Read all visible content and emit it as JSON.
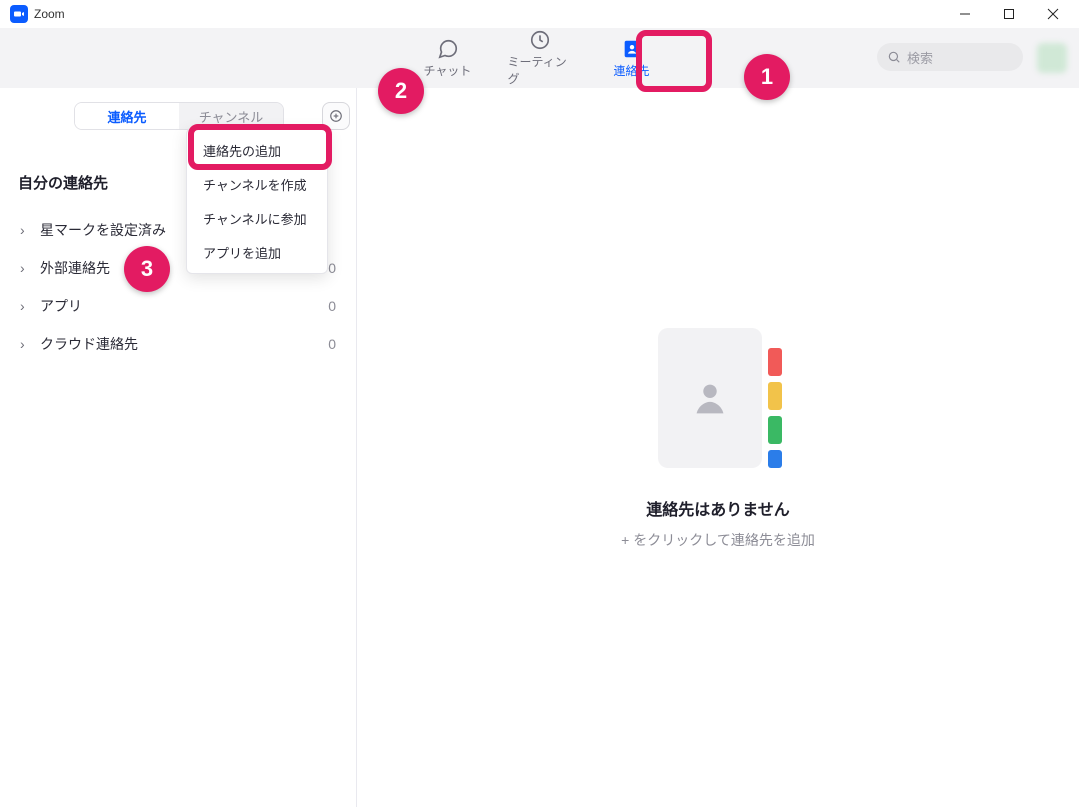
{
  "window": {
    "title": "Zoom"
  },
  "nav": {
    "chat": "チャット",
    "meetings": "ミーティング",
    "contacts": "連絡先"
  },
  "search": {
    "placeholder": "検索"
  },
  "subtabs": {
    "contacts": "連絡先",
    "channels": "チャンネル"
  },
  "dropdown": {
    "add_contact": "連絡先の追加",
    "create_channel": "チャンネルを作成",
    "join_channel": "チャンネルに参加",
    "add_app": "アプリを追加"
  },
  "sidebar": {
    "section_title": "自分の連絡先",
    "items": [
      {
        "label": "星マークを設定済み",
        "count": ""
      },
      {
        "label": "外部連絡先",
        "count": "0"
      },
      {
        "label": "アプリ",
        "count": "0"
      },
      {
        "label": "クラウド連絡先",
        "count": "0"
      }
    ]
  },
  "empty": {
    "title": "連絡先はありません",
    "sub": "+ をクリックして連絡先を追加"
  },
  "steps": {
    "1": "1",
    "2": "2",
    "3": "3"
  }
}
